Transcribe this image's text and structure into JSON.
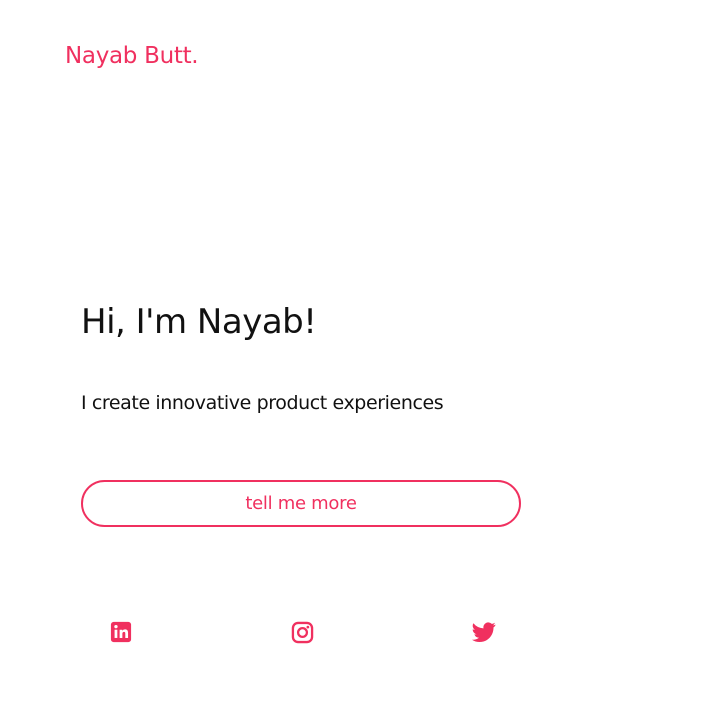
{
  "brand": {
    "name": "Nayab Butt.",
    "accent_color": "#f0305f"
  },
  "hero": {
    "headline": "Hi, I'm Nayab!",
    "tagline": "I create innovative product experiences",
    "cta_label": "tell me more"
  },
  "social": [
    {
      "name": "linkedin",
      "icon": "linkedin-icon"
    },
    {
      "name": "instagram",
      "icon": "instagram-icon"
    },
    {
      "name": "twitter",
      "icon": "twitter-icon"
    }
  ]
}
